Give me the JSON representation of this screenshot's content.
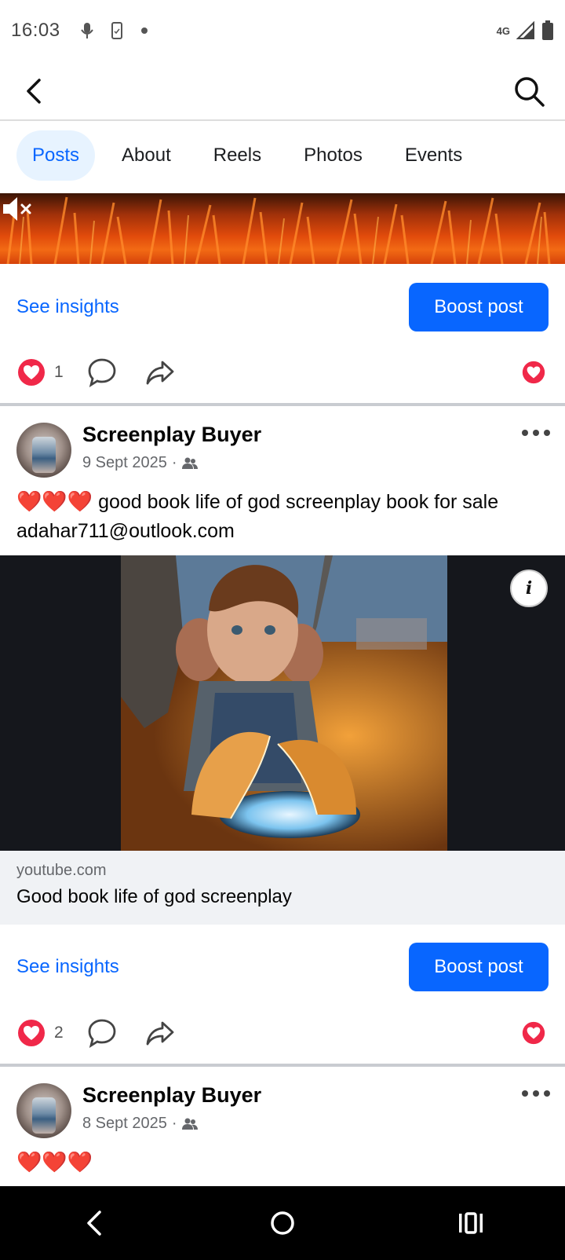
{
  "status_bar": {
    "time": "16:03",
    "network": "4G"
  },
  "tabs": [
    {
      "label": "Posts",
      "active": true
    },
    {
      "label": "About",
      "active": false
    },
    {
      "label": "Reels",
      "active": false
    },
    {
      "label": "Photos",
      "active": false
    },
    {
      "label": "Events",
      "active": false
    }
  ],
  "first_post": {
    "see_insights": "See insights",
    "boost": "Boost post",
    "like_count": "1"
  },
  "second_post": {
    "author": "Screenplay Buyer",
    "date": "9 Sept 2025",
    "date_separator": "·",
    "hearts": "❤️❤️❤️",
    "text": " good book life of god screenplay book for sale adahar711@outlook.com",
    "link": {
      "domain": "youtube.com",
      "title": "Good book life of god screenplay"
    },
    "see_insights": "See insights",
    "boost": "Boost post",
    "like_count": "2"
  },
  "third_post": {
    "author": "Screenplay Buyer",
    "date": "8 Sept 2025",
    "date_separator": "·",
    "hearts": "❤️❤️❤️"
  },
  "colors": {
    "accent": "#0866ff",
    "like": "#f02849",
    "tab_active_bg": "#e7f3ff"
  }
}
